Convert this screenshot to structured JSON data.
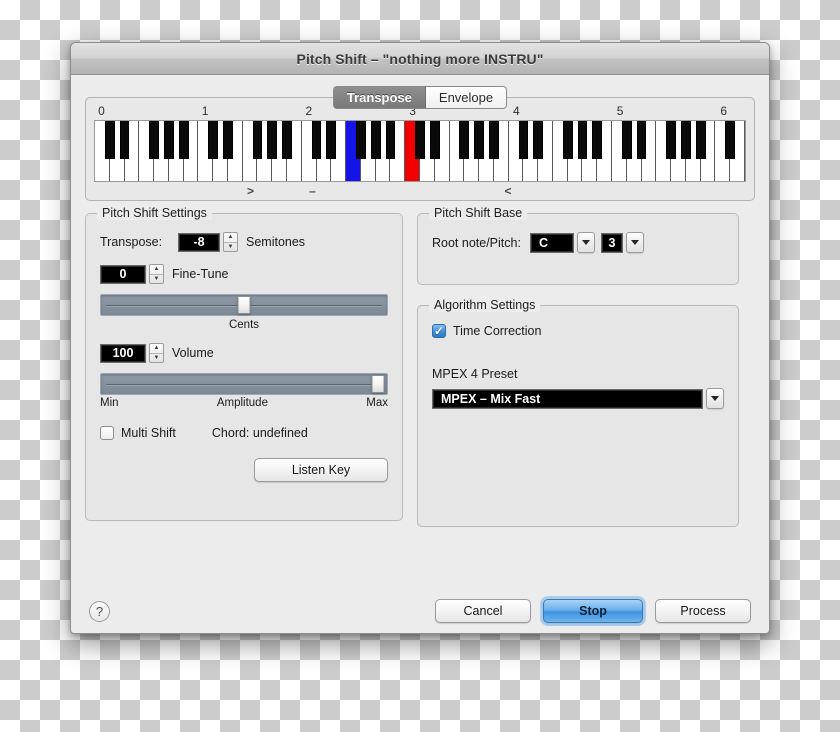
{
  "window": {
    "title": "Pitch Shift – \"nothing more INSTRU\""
  },
  "tabs": [
    {
      "label": "Transpose",
      "selected": true
    },
    {
      "label": "Envelope",
      "selected": false
    }
  ],
  "keyboard": {
    "octave_labels": [
      "0",
      "1",
      "2",
      "3",
      "4",
      "5",
      "6"
    ],
    "markers": [
      {
        "label": ">",
        "pos_pct": 24.0
      },
      {
        "label": "–",
        "pos_pct": 33.5
      },
      {
        "label": "<",
        "pos_pct": 63.5
      }
    ],
    "highlighted_keys": [
      {
        "color": "#1414e6",
        "name": "blue-key",
        "white_index": 17
      },
      {
        "color": "#f20000",
        "name": "red-key",
        "white_index": 21
      }
    ],
    "white_key_count": 44
  },
  "pitch_shift_settings": {
    "group_label": "Pitch Shift Settings",
    "transpose_label": "Transpose:",
    "transpose_value": "-8",
    "transpose_unit": "Semitones",
    "fine_tune_value": "0",
    "fine_tune_label": "Fine-Tune",
    "cents_label": "Cents",
    "cents_thumb_pct": 50,
    "volume_value": "100",
    "volume_label": "Volume",
    "amplitude_min_label": "Min",
    "amplitude_label": "Amplitude",
    "amplitude_max_label": "Max",
    "amplitude_thumb_pct": 97,
    "multi_shift_label": "Multi Shift",
    "multi_shift_checked": false,
    "chord_label": "Chord: undefined",
    "listen_key_label": "Listen Key"
  },
  "pitch_shift_base": {
    "group_label": "Pitch Shift Base",
    "root_note_label": "Root note/Pitch:",
    "root_note_value": "C",
    "pitch_value": "3"
  },
  "algorithm_settings": {
    "group_label": "Algorithm Settings",
    "time_correction_label": "Time Correction",
    "time_correction_checked": true,
    "preset_label": "MPEX 4 Preset",
    "preset_value": "MPEX – Mix Fast"
  },
  "footer": {
    "help_label": "?",
    "cancel_label": "Cancel",
    "stop_label": "Stop",
    "process_label": "Process"
  },
  "colors": {
    "accent_blue": "#3f93e0",
    "key_blue": "#1414e6",
    "key_red": "#f20000"
  }
}
